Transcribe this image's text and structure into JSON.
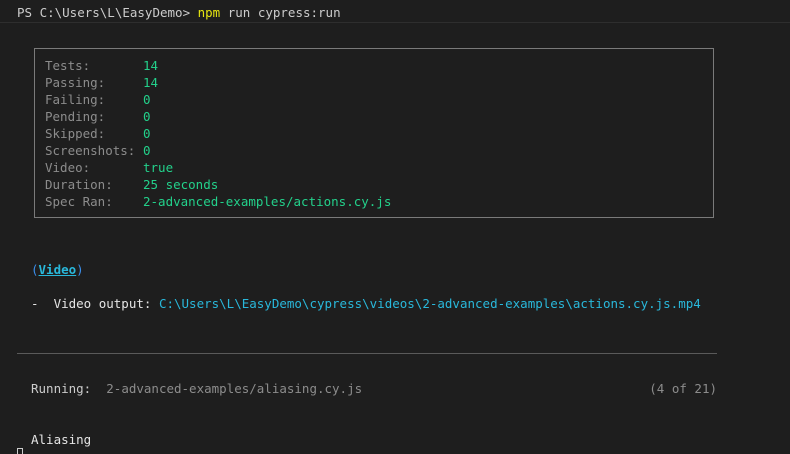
{
  "prompt": {
    "ps_path": "PS C:\\Users\\L\\EasyDemo> ",
    "npm": "npm",
    "args": " run cypress:run"
  },
  "results": [
    {
      "label": "Tests:",
      "value": "14"
    },
    {
      "label": "Passing:",
      "value": "14"
    },
    {
      "label": "Failing:",
      "value": "0"
    },
    {
      "label": "Pending:",
      "value": "0"
    },
    {
      "label": "Skipped:",
      "value": "0"
    },
    {
      "label": "Screenshots:",
      "value": "0"
    },
    {
      "label": "Video:",
      "value": "true"
    },
    {
      "label": "Duration:",
      "value": "25 seconds"
    },
    {
      "label": "Spec Ran:",
      "value": "2-advanced-examples/actions.cy.js"
    }
  ],
  "video": {
    "heading_open": "(",
    "heading_text": "Video",
    "heading_close": ")",
    "output_label": "-  Video output: ",
    "output_path": "C:\\Users\\L\\EasyDemo\\cypress\\videos\\2-advanced-examples\\actions.cy.js.mp4"
  },
  "running": {
    "label": "Running:  ",
    "spec": "2-advanced-examples/aliasing.cy.js",
    "count": "(4 of 21)"
  },
  "suite": {
    "title": "Aliasing"
  },
  "colors": {
    "background": "#1e1e1e",
    "value_green": "#23d18b",
    "path_cyan": "#29b8db",
    "npm_yellow": "#e5e510"
  }
}
